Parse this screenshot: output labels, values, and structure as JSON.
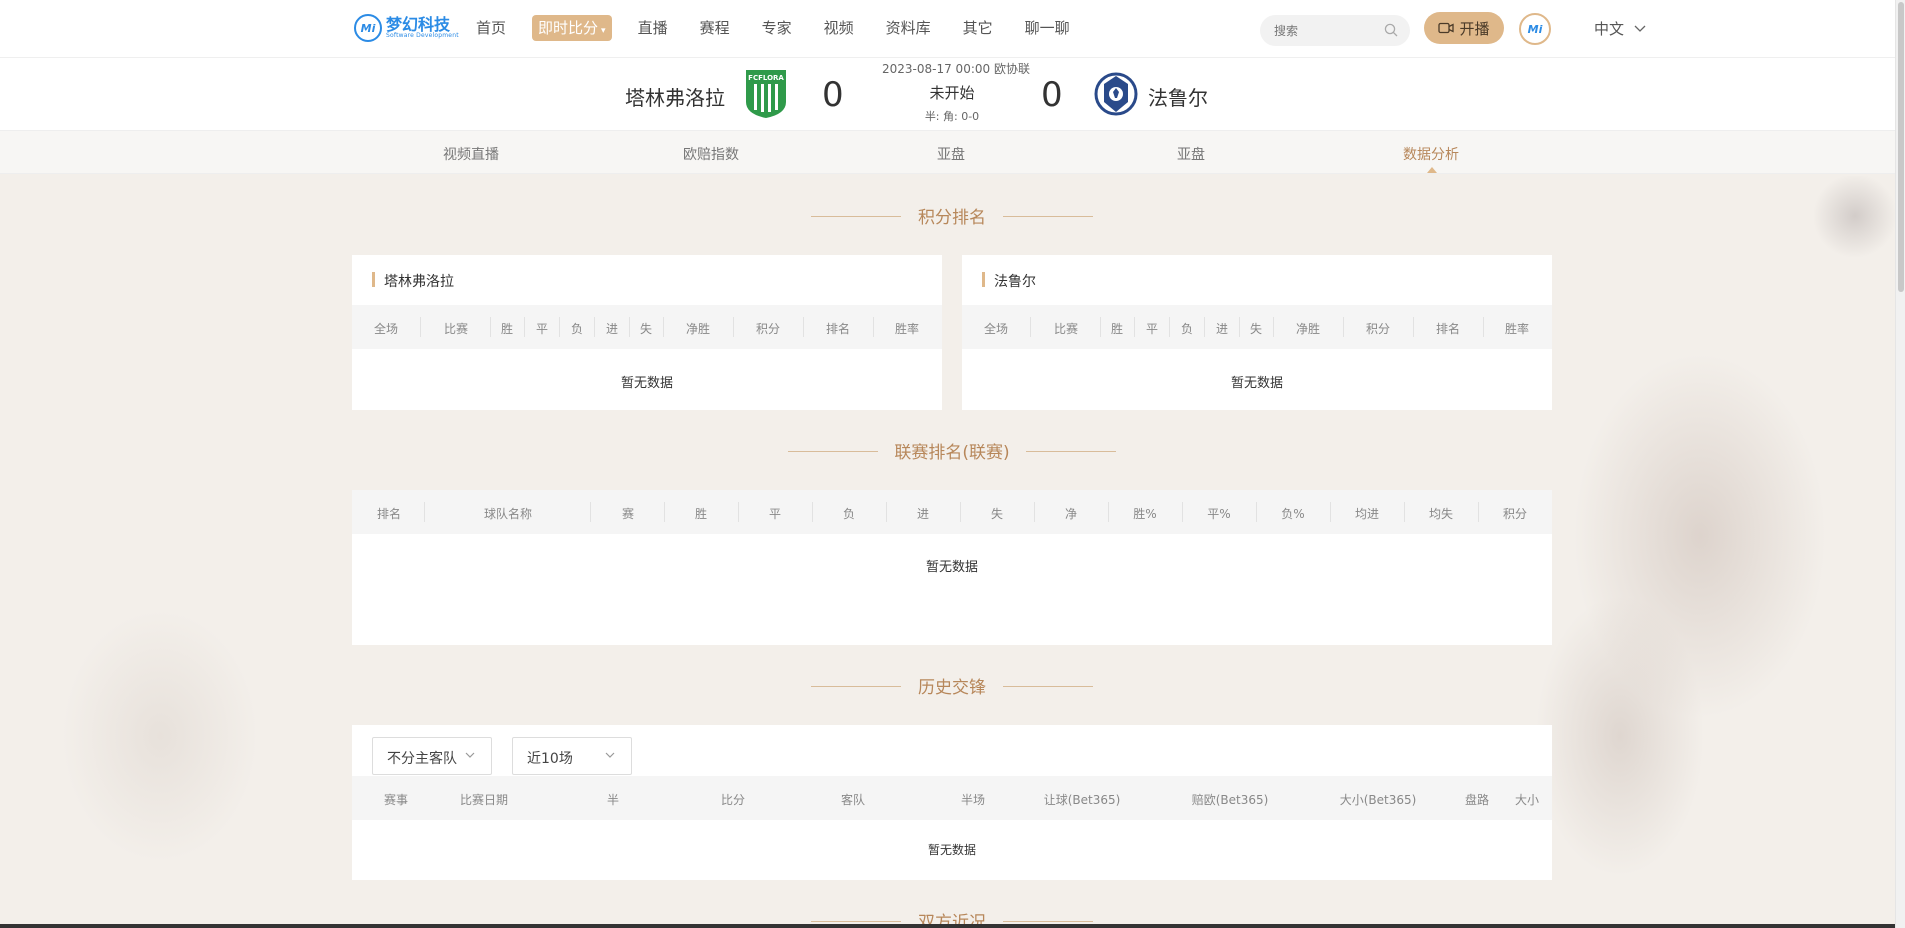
{
  "nav": {
    "logo_cn": "梦幻科技",
    "logo_en": "Software Development",
    "logo_mark": "Mi",
    "items": [
      {
        "label": "首页"
      },
      {
        "label": "即时比分"
      },
      {
        "label": "直播"
      },
      {
        "label": "赛程"
      },
      {
        "label": "专家"
      },
      {
        "label": "视频"
      },
      {
        "label": "资料库"
      },
      {
        "label": "其它"
      },
      {
        "label": "聊一聊"
      }
    ],
    "active_caret": "▾",
    "search_placeholder": "搜索",
    "live_label": "开播",
    "avatar_text": "Mi",
    "language": "中文"
  },
  "match": {
    "home_name": "塔林弗洛拉",
    "home_score": "0",
    "away_score": "0",
    "away_name": "法鲁尔",
    "time_league": "2023-08-17 00:00 欧协联",
    "status": "未开始",
    "half_corner": "半:  角: 0-0"
  },
  "tabs": [
    "视频直播",
    "欧赔指数",
    "亚盘",
    "亚盘",
    "数据分析"
  ],
  "standings": {
    "title": "积分排名",
    "home_card_title": "塔林弗洛拉",
    "away_card_title": "法鲁尔",
    "columns": [
      "全场",
      "比赛",
      "胜",
      "平",
      "负",
      "进",
      "失",
      "净胜",
      "积分",
      "排名",
      "胜率"
    ],
    "empty": "暂无数据"
  },
  "league_rank": {
    "title": "联赛排名(联赛)",
    "columns": [
      "排名",
      "球队名称",
      "赛",
      "胜",
      "平",
      "负",
      "进",
      "失",
      "净",
      "胜%",
      "平%",
      "负%",
      "均进",
      "均失",
      "积分"
    ],
    "empty": "暂无数据"
  },
  "h2h": {
    "title": "历史交锋",
    "filter_side": "不分主客队",
    "filter_count": "近10场",
    "columns": [
      "赛事",
      "比赛日期",
      "半",
      "比分",
      "客队",
      "半场",
      "让球(Bet365)",
      "赔欧(Bet365)",
      "大小(Bet365)",
      "盘路",
      "大小"
    ],
    "empty": "暂无数据"
  },
  "recent": {
    "title": "双方近况"
  },
  "colors": {
    "accent": "#dfb88a",
    "accent_text": "#b7875a",
    "brand_blue": "#2b8be5",
    "home_green": "#2f9a4a",
    "away_blue": "#2a4a8a"
  }
}
